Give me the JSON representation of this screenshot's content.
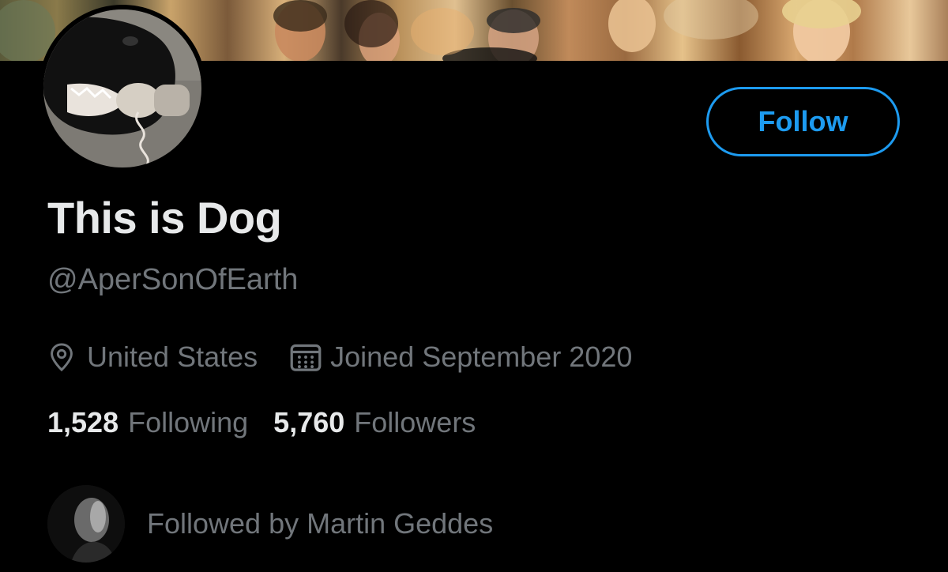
{
  "profile": {
    "display_name": "This is Dog",
    "handle": "@AperSonOfEarth",
    "location": "United States",
    "joined": "Joined September 2020",
    "icons": {
      "location": "location-pin-icon",
      "joined": "calendar-icon"
    }
  },
  "actions": {
    "follow_label": "Follow"
  },
  "stats": {
    "following_count": "1,528",
    "following_label": "Following",
    "followers_count": "5,760",
    "followers_label": "Followers"
  },
  "social_context": {
    "text": "Followed by Martin Geddes"
  },
  "colors": {
    "background": "#000000",
    "accent": "#1d9bf0",
    "primary_text": "#e7e9ea",
    "secondary_text": "#71767b"
  }
}
